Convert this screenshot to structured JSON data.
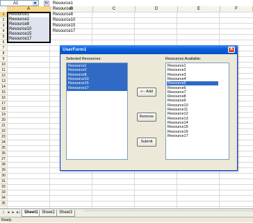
{
  "formula_bar": {
    "name_box": "A1",
    "fx_label": "fx"
  },
  "column_headers": [
    "A",
    "B",
    "C",
    "D",
    "E",
    "F"
  ],
  "row_headers": [
    "1",
    "2",
    "3",
    "4",
    "5",
    "6",
    "7",
    "8",
    "9",
    "10",
    "11",
    "12",
    "13",
    "14",
    "15",
    "16",
    "17",
    "18",
    "19",
    "20",
    "21",
    "22",
    "23",
    "24",
    "25",
    "26",
    "27",
    "28",
    "29",
    "30",
    "31",
    "32",
    "33",
    "34",
    "35"
  ],
  "column_a": [
    "Resource1",
    "Resource2",
    "Resource8",
    "Resource10",
    "Resource15",
    "Resource17"
  ],
  "column_b": [
    "Resource1",
    "Resource2",
    "Resource8",
    "Resource10",
    "Resource15",
    "Resource17"
  ],
  "form": {
    "title": "UserForm1",
    "close_label": "X",
    "selected_label": "Selected Resources:",
    "available_label": "Resources Available:",
    "selected_items": [
      "Resource1",
      "Resource2",
      "Resource8",
      "Resource10",
      "Resource15",
      "Resource17"
    ],
    "available_items": [
      "Resource1",
      "Resource2",
      "Resource3",
      "Resource4",
      "Resource5",
      "Resource6",
      "Resource7",
      "Resource8",
      "Resource9",
      "Resource10",
      "Resource11",
      "Resource12",
      "Resource13",
      "Resource14",
      "Resource15",
      "Resource16",
      "Resource17"
    ],
    "available_highlighted_index": 4,
    "add_label": "<-- Add",
    "remove_label": "Remove",
    "submit_label": "Submit"
  },
  "sheet_tabs": {
    "nav": [
      "|◄",
      "◄",
      "►",
      "►|"
    ],
    "tabs": [
      "Sheet1",
      "Sheet2",
      "Sheet3"
    ],
    "active": "Sheet1"
  },
  "status": "Ready"
}
